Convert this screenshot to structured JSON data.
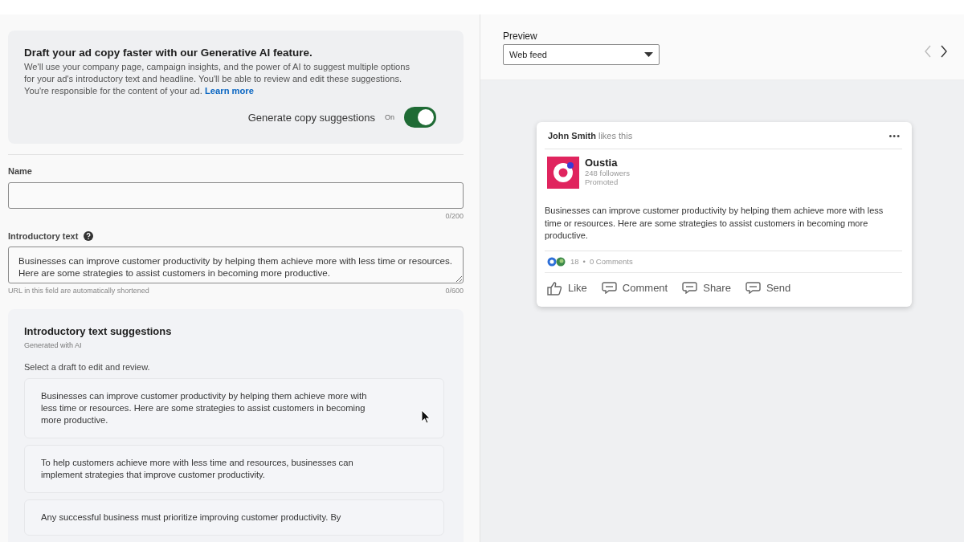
{
  "ai_notice": {
    "title": "Draft your ad copy faster with our Generative AI feature.",
    "body": "We'll use your company page, campaign insights, and the power of AI to suggest multiple options for your ad's introductory text and headline. You'll be able to review and edit these suggestions. You're responsible for the content of your ad.",
    "link": "Learn more",
    "toggle_label": "Generate copy suggestions",
    "toggle_state": "On",
    "on": true
  },
  "name_field": {
    "label": "Name",
    "counter": "0/200"
  },
  "intro_field": {
    "label": "Introductory text",
    "value": "Businesses can improve customer productivity by helping them achieve more with less time or resources. Here are some strategies to assist customers in becoming more productive.",
    "hint": "URL in this field are automatically shortened",
    "counter": "0/600"
  },
  "suggestions": {
    "title": "Introductory text suggestions",
    "subtitle": "Generated with AI",
    "instruction": "Select a draft to edit and review.",
    "items": [
      {
        "text": "Businesses can improve customer productivity by helping them achieve more with less time or resources. Here are some strategies to assist customers in becoming more productive."
      },
      {
        "text": "To help customers achieve more with less time and resources, businesses can implement strategies that improve customer productivity."
      },
      {
        "text": "Any successful business must prioritize improving customer productivity. By"
      }
    ]
  },
  "preview": {
    "label": "Preview",
    "select_value": "Web feed"
  },
  "post": {
    "liker": "John Smith",
    "liker_action": "likes this",
    "more": "•••",
    "company": "Oustia",
    "followers": "248 followers",
    "promoted": "Promoted",
    "body": "Businesses can improve customer productivity by helping them achieve more with less time or resources. Here are some strategies to assist customers in becoming more productive.",
    "reactions": "18",
    "separator": "•",
    "comments": "0 Comments",
    "actions": [
      {
        "kind": "like",
        "label": "Like"
      },
      {
        "kind": "comment",
        "label": "Comment"
      },
      {
        "kind": "share",
        "label": "Share"
      },
      {
        "kind": "send",
        "label": "Send"
      }
    ]
  }
}
